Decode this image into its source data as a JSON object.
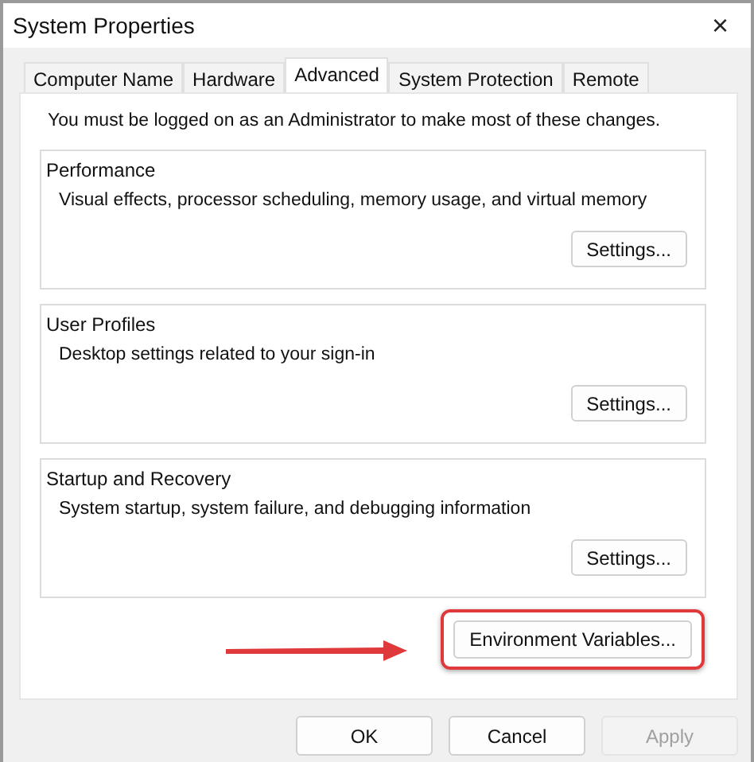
{
  "window": {
    "title": "System Properties",
    "close": "×"
  },
  "tabs": [
    {
      "label": "Computer Name",
      "selected": false
    },
    {
      "label": "Hardware",
      "selected": false
    },
    {
      "label": "Advanced",
      "selected": true
    },
    {
      "label": "System Protection",
      "selected": false
    },
    {
      "label": "Remote",
      "selected": false
    }
  ],
  "notice": "You must be logged on as an Administrator to make most of these changes.",
  "groups": [
    {
      "title": "Performance",
      "description": "Visual effects, processor scheduling, memory usage, and virtual memory",
      "button": "Settings..."
    },
    {
      "title": "User Profiles",
      "description": "Desktop settings related to your sign-in",
      "button": "Settings..."
    },
    {
      "title": "Startup and Recovery",
      "description": "System startup, system failure, and debugging information",
      "button": "Settings..."
    }
  ],
  "environment_button": {
    "label": "Environment Variables..."
  },
  "annotations": [
    {
      "kind": "arrow"
    },
    {
      "kind": "highlight"
    }
  ],
  "buttons": [
    {
      "label": "OK",
      "disabled": false
    },
    {
      "label": "Cancel",
      "disabled": false
    },
    {
      "label": "Apply",
      "disabled": true
    }
  ]
}
